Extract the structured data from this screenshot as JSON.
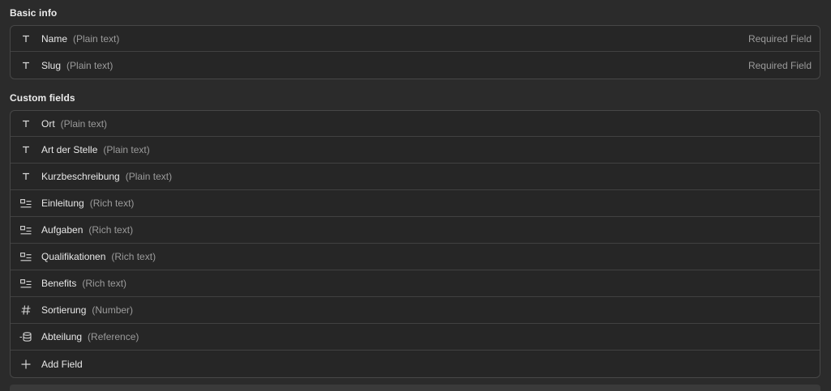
{
  "basic_info": {
    "title": "Basic info",
    "fields": [
      {
        "icon": "text-icon",
        "name": "Name",
        "type": "(Plain text)",
        "note": "Required Field"
      },
      {
        "icon": "text-icon",
        "name": "Slug",
        "type": "(Plain text)",
        "note": "Required Field"
      }
    ]
  },
  "custom_fields": {
    "title": "Custom fields",
    "fields": [
      {
        "icon": "text-icon",
        "name": "Ort",
        "type": "(Plain text)"
      },
      {
        "icon": "text-icon",
        "name": "Art der Stelle",
        "type": "(Plain text)"
      },
      {
        "icon": "text-icon",
        "name": "Kurzbeschreibung",
        "type": "(Plain text)"
      },
      {
        "icon": "rich-text-icon",
        "name": "Einleitung",
        "type": "(Rich text)"
      },
      {
        "icon": "rich-text-icon",
        "name": "Aufgaben",
        "type": "(Rich text)"
      },
      {
        "icon": "rich-text-icon",
        "name": "Qualifikationen",
        "type": "(Rich text)"
      },
      {
        "icon": "rich-text-icon",
        "name": "Benefits",
        "type": "(Rich text)"
      },
      {
        "icon": "hash-icon",
        "name": "Sortierung",
        "type": "(Number)"
      },
      {
        "icon": "reference-icon",
        "name": "Abteilung",
        "type": "(Reference)"
      }
    ],
    "add_field_label": "Add Field"
  }
}
